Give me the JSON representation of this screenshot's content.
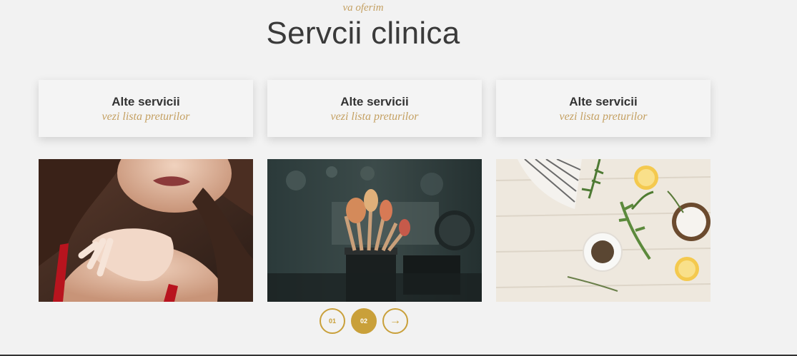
{
  "header": {
    "subtitle": "va oferim",
    "title": "Servcii clinica"
  },
  "service_cards": [
    {
      "title": "Alte servicii",
      "link": "vezi lista preturilor"
    },
    {
      "title": "Alte servicii",
      "link": "vezi lista preturilor"
    },
    {
      "title": "Alte servicii",
      "link": "vezi lista preturilor"
    }
  ],
  "gallery": {
    "images": [
      "woman-shoulder-photo",
      "makeup-brushes-photo",
      "spa-ingredients-photo"
    ]
  },
  "pagination": {
    "pages": [
      "01",
      "02"
    ],
    "active": "02",
    "next": "→"
  },
  "colors": {
    "accent": "#c9a03a",
    "background": "#f2f2f2",
    "text": "#3a3a3a"
  }
}
